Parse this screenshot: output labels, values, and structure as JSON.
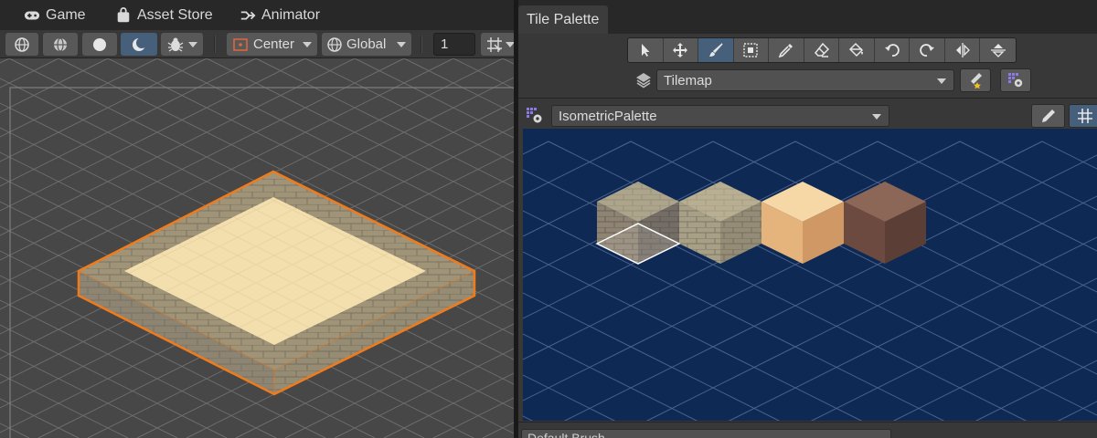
{
  "scene": {
    "tabs": [
      {
        "label": "Game",
        "icon": "gamepad-icon"
      },
      {
        "label": "Asset Store",
        "icon": "shopping-bag-icon"
      },
      {
        "label": "Animator",
        "icon": "animator-icon"
      }
    ],
    "toolbar": {
      "pivot_mode": "Center",
      "pivot_rotation": "Global",
      "grid_snap_value": "1"
    }
  },
  "palette": {
    "tab_label": "Tile Palette",
    "tools": [
      "select-tool-icon",
      "move-tool-icon",
      "paint-brush-icon",
      "box-fill-icon",
      "eyedropper-icon",
      "eraser-icon",
      "fill-bucket-icon",
      "rotate-ccw-icon",
      "rotate-cw-icon",
      "flip-x-icon",
      "flip-y-icon"
    ],
    "active_tool": "paint-brush-icon",
    "active_target": "Tilemap",
    "palette_name": "IsometricPalette",
    "brush": "Default Brush",
    "tiles": [
      "stone-brick",
      "stone-brick-light",
      "sand",
      "dirt"
    ]
  },
  "colors": {
    "accent_selected": "#46607c",
    "selection_outline": "#f07b1c",
    "palette_background": "#0f2955",
    "scene_background": "#474747"
  }
}
